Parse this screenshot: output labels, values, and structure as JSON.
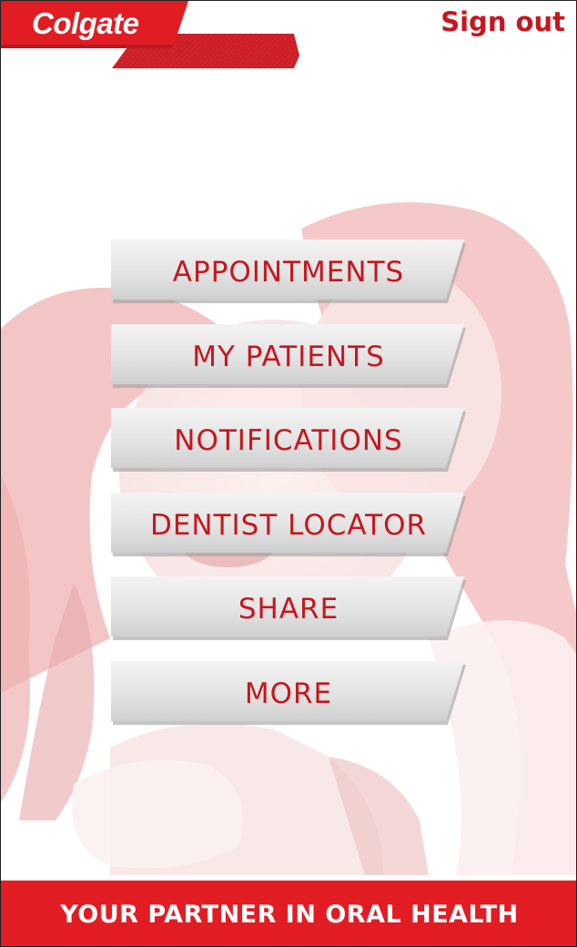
{
  "header": {
    "logo_text": "Colgate",
    "sign_out_label": "Sign out"
  },
  "menu": {
    "items": [
      {
        "label": "APPOINTMENTS"
      },
      {
        "label": "MY PATIENTS"
      },
      {
        "label": "NOTIFICATIONS"
      },
      {
        "label": "DENTIST LOCATOR"
      },
      {
        "label": "SHARE"
      },
      {
        "label": "MORE"
      }
    ]
  },
  "footer": {
    "tagline": "YOUR PARTNER IN ORAL HEALTH"
  },
  "colors": {
    "brand_red": "#e21c23",
    "label_red": "#c8161d",
    "button_gray": "#e6e6e6"
  },
  "icons": [
    "colgate-logo"
  ]
}
